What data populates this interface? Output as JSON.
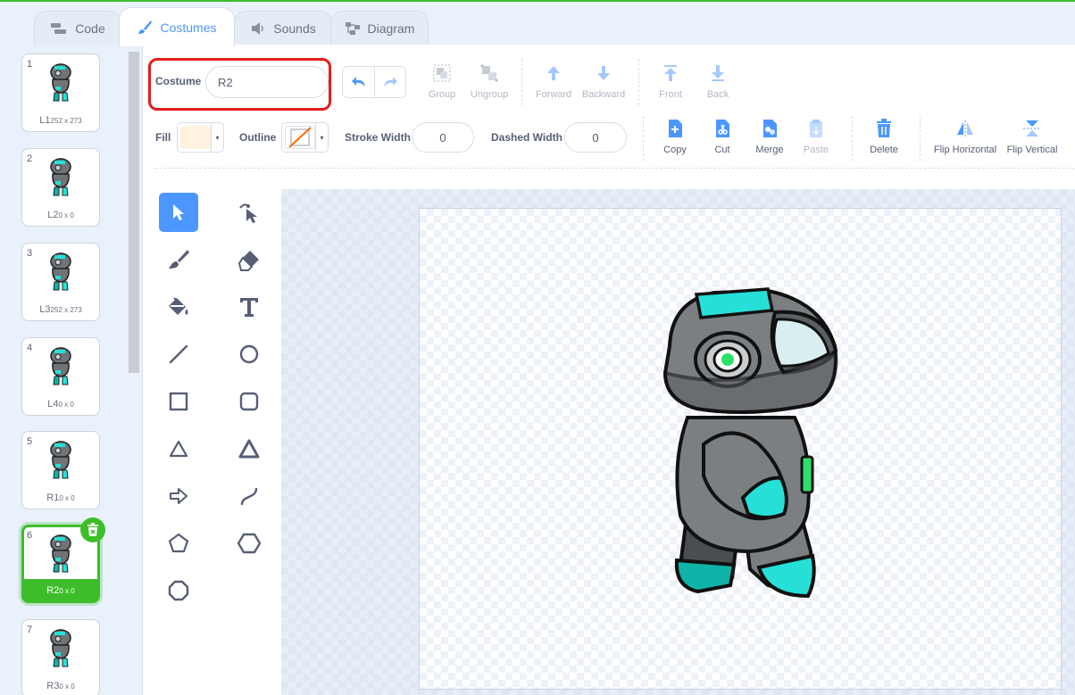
{
  "tabs": [
    {
      "label": "Code",
      "icon": "code-blocks-icon"
    },
    {
      "label": "Costumes",
      "icon": "paintbrush-icon"
    },
    {
      "label": "Sounds",
      "icon": "speaker-icon"
    },
    {
      "label": "Diagram",
      "icon": "diagram-icon"
    }
  ],
  "active_tab": "Costumes",
  "costumes": [
    {
      "number": "1",
      "name": "L1",
      "size": "252 x 273"
    },
    {
      "number": "2",
      "name": "L2",
      "size": "0 x 0"
    },
    {
      "number": "3",
      "name": "L3",
      "size": "252 x 273"
    },
    {
      "number": "4",
      "name": "L4",
      "size": "0 x 0"
    },
    {
      "number": "5",
      "name": "R1",
      "size": "0 x 0"
    },
    {
      "number": "6",
      "name": "R2",
      "size": "0 x 0"
    },
    {
      "number": "7",
      "name": "R3",
      "size": "0 x 0"
    }
  ],
  "selected_costume": "6",
  "editor": {
    "costume_label": "Costume",
    "costume_name": "R2",
    "fill_label": "Fill",
    "outline_label": "Outline",
    "stroke_width_label": "Stroke Width",
    "stroke_width": "0",
    "dashed_width_label": "Dashed Width",
    "dashed_width": "0",
    "fill_color": "#fff3e0",
    "outline_color": "#ff6a00"
  },
  "toolbar": {
    "group": "Group",
    "ungroup": "Ungroup",
    "forward": "Forward",
    "backward": "Backward",
    "front": "Front",
    "back": "Back",
    "copy": "Copy",
    "cut": "Cut",
    "merge": "Merge",
    "paste": "Paste",
    "delete": "Delete",
    "flip_horizontal": "Flip Horizontal",
    "flip_vertical": "Flip Vertical"
  },
  "tools": [
    "select",
    "reshape",
    "brush",
    "eraser",
    "fill",
    "text",
    "line",
    "circle",
    "rectangle",
    "rounded-rectangle",
    "triangle-outline",
    "triangle",
    "arrow",
    "curve",
    "pentagon",
    "hexagon",
    "octagon"
  ],
  "colors": {
    "accent": "#4c97ff",
    "selected": "#3dbd2a",
    "highlight_box": "#e21d1d",
    "robot_teal": "#26e0d8",
    "robot_gray": "#7b7f82"
  }
}
